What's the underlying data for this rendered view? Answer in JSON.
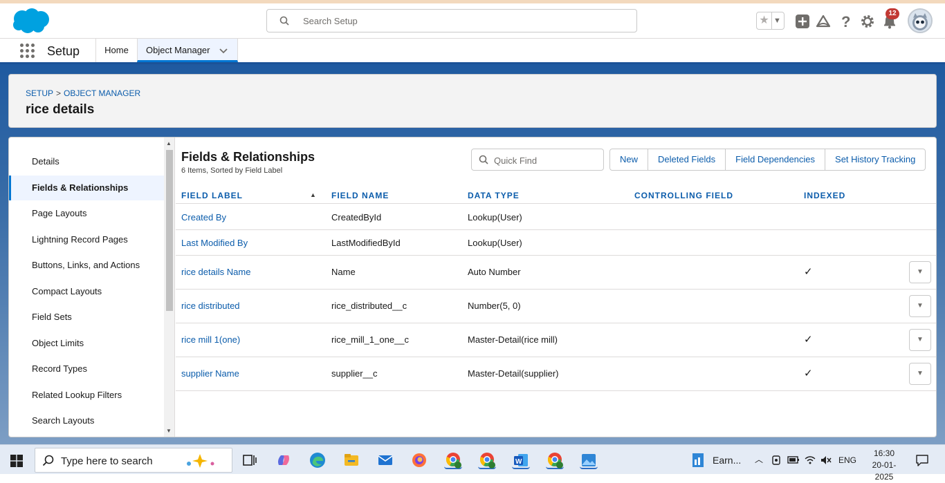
{
  "header": {
    "search_placeholder": "Search Setup",
    "notification_count": "12"
  },
  "nav": {
    "app_name": "Setup",
    "tabs": [
      {
        "label": "Home"
      },
      {
        "label": "Object Manager"
      }
    ]
  },
  "breadcrumb": {
    "items": [
      "SETUP",
      "OBJECT MANAGER"
    ],
    "separator": ">"
  },
  "page_title": "rice details",
  "sidebar": {
    "items": [
      {
        "label": "Details"
      },
      {
        "label": "Fields & Relationships",
        "active": true
      },
      {
        "label": "Page Layouts"
      },
      {
        "label": "Lightning Record Pages"
      },
      {
        "label": "Buttons, Links, and Actions"
      },
      {
        "label": "Compact Layouts"
      },
      {
        "label": "Field Sets"
      },
      {
        "label": "Object Limits"
      },
      {
        "label": "Record Types"
      },
      {
        "label": "Related Lookup Filters"
      },
      {
        "label": "Search Layouts"
      }
    ]
  },
  "content": {
    "title": "Fields & Relationships",
    "subtitle": "6 Items, Sorted by Field Label",
    "quick_find_placeholder": "Quick Find",
    "buttons": [
      "New",
      "Deleted Fields",
      "Field Dependencies",
      "Set History Tracking"
    ],
    "columns": [
      "FIELD LABEL",
      "FIELD NAME",
      "DATA TYPE",
      "CONTROLLING FIELD",
      "INDEXED"
    ],
    "rows": [
      {
        "label": "Created By",
        "name": "CreatedById",
        "type": "Lookup(User)",
        "controlling": "",
        "indexed": false,
        "menu": false
      },
      {
        "label": "Last Modified By",
        "name": "LastModifiedById",
        "type": "Lookup(User)",
        "controlling": "",
        "indexed": false,
        "menu": false
      },
      {
        "label": "rice details Name",
        "name": "Name",
        "type": "Auto Number",
        "controlling": "",
        "indexed": true,
        "menu": true
      },
      {
        "label": "rice distributed",
        "name": "rice_distributed__c",
        "type": "Number(5, 0)",
        "controlling": "",
        "indexed": false,
        "menu": true
      },
      {
        "label": "rice mill 1(one)",
        "name": "rice_mill_1_one__c",
        "type": "Master-Detail(rice mill)",
        "controlling": "",
        "indexed": true,
        "menu": true
      },
      {
        "label": "supplier Name",
        "name": "supplier__c",
        "type": "Master-Detail(supplier)",
        "controlling": "",
        "indexed": true,
        "menu": true
      }
    ]
  },
  "taskbar": {
    "search_placeholder": "Type here to search",
    "news_label": "Earn...",
    "language": "ENG",
    "time": "16:30",
    "date": "20-01-2025"
  },
  "colors": {
    "brand": "#0176d3",
    "link": "#0b5cab",
    "header_band": "#1b5297",
    "badge": "#c23934"
  }
}
